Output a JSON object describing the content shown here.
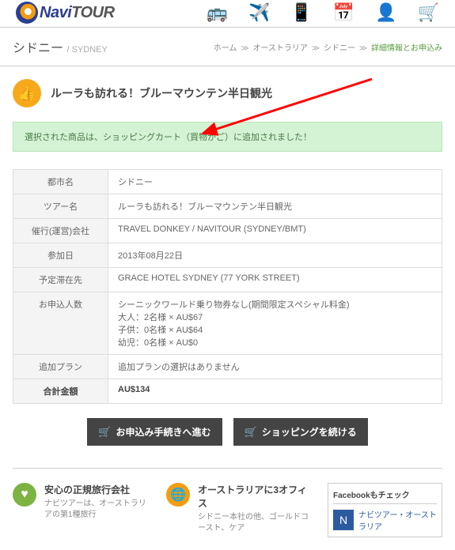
{
  "logo": {
    "brand": "Navi",
    "suffix": "TOUR"
  },
  "breadcrumb": {
    "city": "シドニー",
    "city_sub": "/ SYDNEY",
    "home": "ホーム",
    "country": "オーストラリア",
    "city2": "シドニー",
    "current": "詳細情報とお申込み"
  },
  "page": {
    "title": "ルーラも訪れる！ブルーマウンテン半日観光",
    "alert": "選択された商品は、ショッピングカート（買物かご）に追加されました！"
  },
  "details": {
    "rows": [
      {
        "label": "都市名",
        "value": "シドニー"
      },
      {
        "label": "ツアー名",
        "value": "ルーラも訪れる！ブルーマウンテン半日観光"
      },
      {
        "label": "催行(運営)会社",
        "value": "TRAVEL DONKEY / NAVITOUR (SYDNEY/BMT)"
      },
      {
        "label": "参加日",
        "value": "2013年08月22日"
      },
      {
        "label": "予定滞在先",
        "value": "GRACE HOTEL SYDNEY (77 YORK STREET)"
      },
      {
        "label": "お申込人数",
        "value": "シーニックワールド乗り物券なし(期間限定スペシャル料金)\n大人：2名様 × AU$67\n子供：0名様 × AU$64\n幼児：0名様 × AU$0"
      },
      {
        "label": "追加プラン",
        "value": "追加プランの選択はありません"
      }
    ],
    "total_label": "合計金額",
    "total_value": "AU$134"
  },
  "buttons": {
    "checkout": "お申込み手続きへ進む",
    "continue": "ショッピングを続ける"
  },
  "footer": {
    "col1_title": "安心の正規旅行会社",
    "col1_body": "ナビツアーは、オーストラリアの第1種旅行",
    "col2_title": "オーストラリアに3オフィス",
    "col2_body": "シドニー本社の他、ゴールドコースト、ケア",
    "fb_head": "Facebookもチェック",
    "fb_item": "ナビツアー・オーストラリア"
  }
}
